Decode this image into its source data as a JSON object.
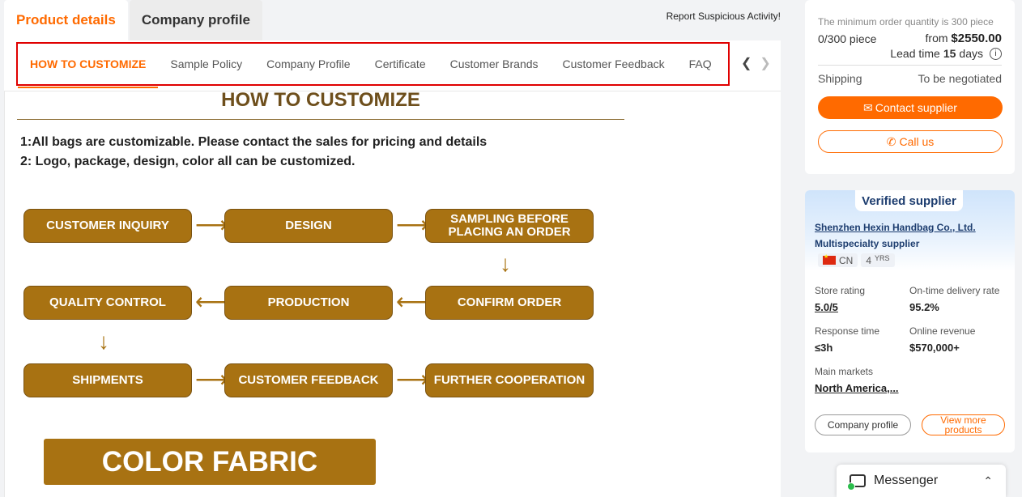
{
  "top_tabs": [
    {
      "label": "Product details",
      "active": true
    },
    {
      "label": "Company profile",
      "active": false
    }
  ],
  "report_link": "Report Suspicious Activity!",
  "subnav": {
    "items": [
      {
        "label": "HOW TO CUSTOMIZE",
        "active": true
      },
      {
        "label": "Sample Policy",
        "active": false
      },
      {
        "label": "Company Profile",
        "active": false
      },
      {
        "label": "Certificate",
        "active": false
      },
      {
        "label": "Customer Brands",
        "active": false
      },
      {
        "label": "Customer Feedback",
        "active": false
      },
      {
        "label": "FAQ",
        "active": false
      }
    ],
    "prev_icon": "chevron-left-icon",
    "next_icon": "chevron-right-icon"
  },
  "content": {
    "title": "HOW TO CUSTOMIZE",
    "lines": [
      "1:All bags are customizable. Please contact the sales for pricing and details",
      "2: Logo, package, design, color all can be customized."
    ],
    "flow": {
      "row1": [
        "CUSTOMER INQUIRY",
        "DESIGN",
        "SAMPLING BEFORE PLACING AN ORDER"
      ],
      "row2": [
        "QUALITY CONTROL",
        "PRODUCTION",
        "CONFIRM ORDER"
      ],
      "row3": [
        "SHIPMENTS",
        "CUSTOMER FEEDBACK",
        "FURTHER COOPERATION"
      ]
    },
    "banner": "COLOR FABRIC"
  },
  "order_card": {
    "min_order_note": "The minimum order quantity is 300 piece",
    "quantity": "0/300 piece",
    "price_prefix": "from",
    "price": "$2550.00",
    "lead_time_label": "Lead time",
    "lead_time_value": "15",
    "lead_time_unit": "days",
    "shipping_label": "Shipping",
    "shipping_value": "To be negotiated",
    "contact_button": "Contact supplier",
    "call_button": "Call us"
  },
  "supplier_card": {
    "badge": "Verified supplier",
    "company_name": "Shenzhen Hexin Handbag Co., Ltd.",
    "supplier_type": "Multispecialty supplier",
    "country": "CN",
    "years": "4",
    "years_unit": "YRS",
    "stats": [
      {
        "label": "Store rating",
        "value": "5.0/5"
      },
      {
        "label": "On-time delivery rate",
        "value": "95.2%"
      },
      {
        "label": "Response time",
        "value": "≤3h"
      },
      {
        "label": "Online revenue",
        "value": "$570,000+"
      },
      {
        "label": "Main markets",
        "value": "North America,..."
      }
    ],
    "company_profile_button": "Company profile",
    "view_more_button": "View more products"
  },
  "messenger": {
    "label": "Messenger"
  },
  "colors": {
    "accent": "#ff6a00",
    "flow_box": "#a87212",
    "title_brown": "#6e4f1c",
    "highlight_border": "#e00000"
  }
}
